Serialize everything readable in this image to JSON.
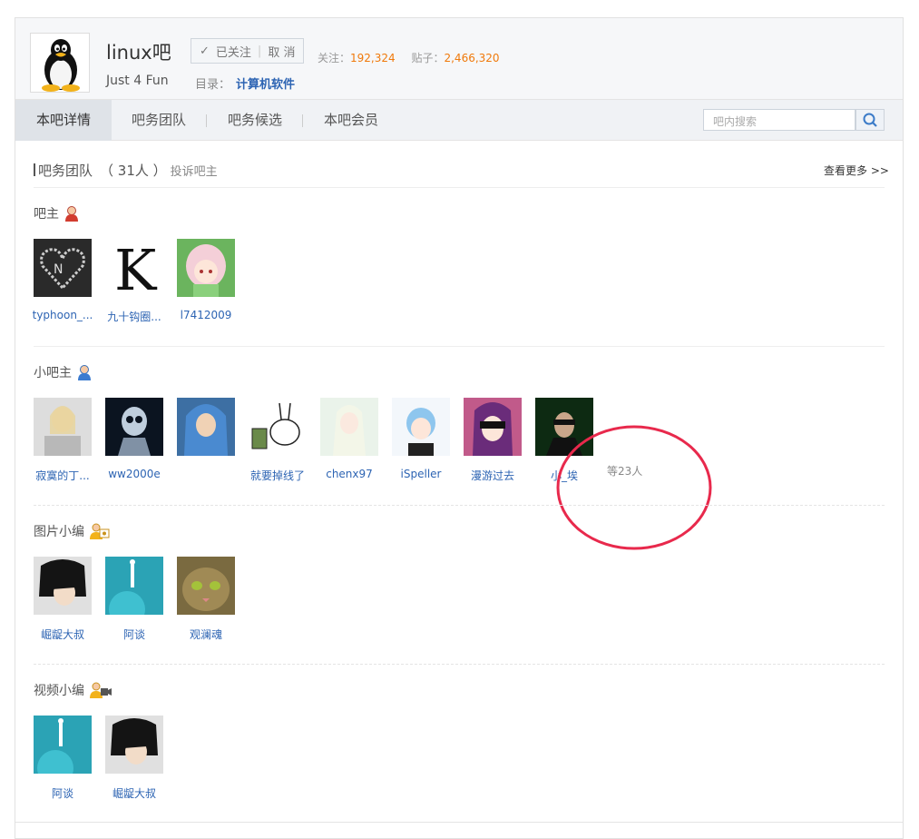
{
  "forum": {
    "title": "linux吧",
    "slogan": "Just 4 Fun",
    "follow": {
      "status": "已关注",
      "separator": "|",
      "cancel": "取 消"
    },
    "stats": {
      "follow_label": "关注：",
      "follow_count": "192,324",
      "post_label": "贴子：",
      "post_count": "2,466,320"
    },
    "catalog": {
      "label": "目录：",
      "value": "计算机软件"
    }
  },
  "nav": {
    "tabs": [
      {
        "label": "本吧详情",
        "active": true
      },
      {
        "label": "吧务团队",
        "active": false
      },
      {
        "label": "吧务候选",
        "active": false
      },
      {
        "label": "本吧会员",
        "active": false
      }
    ],
    "search_placeholder": "吧内搜索"
  },
  "team": {
    "title": "吧务团队",
    "count": "（ 31人 ）",
    "complain": "投诉吧主",
    "more": "查看更多 >>",
    "groups": [
      {
        "label": "吧主",
        "icon": "owner-icon",
        "members": [
          "typhoon_...",
          "九十钩圈...",
          "l7412009"
        ]
      },
      {
        "label": "小吧主",
        "icon": "assistant-icon",
        "members": [
          "寂寞的丁...",
          "ww2000e",
          "",
          "就要掉线了",
          "chenx97",
          "iSpeller",
          "漫游过去",
          "小_埃"
        ],
        "etc": "等23人"
      },
      {
        "label": "图片小编",
        "icon": "picture-editor-icon",
        "members": [
          "崛龊大叔",
          "阿谈",
          "观澜魂"
        ]
      },
      {
        "label": "视频小编",
        "icon": "video-editor-icon",
        "members": [
          "阿谈",
          "崛龊大叔"
        ]
      }
    ]
  },
  "colors": {
    "link": "#2d64b3",
    "stat_number": "#f0790b",
    "annotation": "#e8294c"
  }
}
